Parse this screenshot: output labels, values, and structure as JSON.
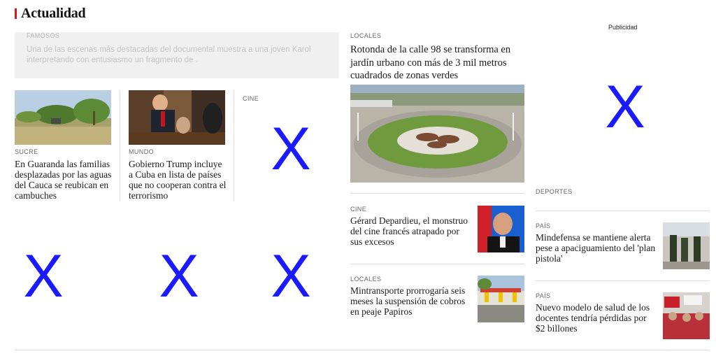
{
  "section": {
    "title": "Actualidad"
  },
  "ad": {
    "label": "Publicidad"
  },
  "famosos": {
    "kicker": "FAMOSOS",
    "text": "Una de las escenas más destacadas del documental muestra a una joven Karol interpretando con entusiasmo un fragmento de ."
  },
  "left_cards": [
    {
      "kicker": "SUCRE",
      "headline": "En Guaranda las familias desplazadas por las aguas del Cauca se reubican en cambuches"
    },
    {
      "kicker": "MUNDO",
      "headline": "Gobierno Trump incluye a Cuba en lista de países que no cooperan contra el terrorismo"
    },
    {
      "kicker": "CINE",
      "headline": ""
    }
  ],
  "center_main": {
    "kicker": "LOCALES",
    "headline": "Rotonda de la calle 98 se transforma en jardín urbano con más de 3 mil metros cuadrados de zonas verdes"
  },
  "center_list": [
    {
      "kicker": "CINE",
      "headline": "Gérard Depardieu, el monstruo del cine francés atrapado por sus excesos"
    },
    {
      "kicker": "LOCALES",
      "headline": "Mintransporte prorrogaría seis meses la suspensión de cobros en peaje Papiros"
    }
  ],
  "right_section": {
    "kicker": "DEPORTES"
  },
  "right_list": [
    {
      "kicker": "PAÍS",
      "headline": "Mindefensa se mantiene alerta pese a apaciguamiento del 'plan pistola'"
    },
    {
      "kicker": "PAÍS",
      "headline": "Nuevo modelo de salud de los docentes tendría pérdidas por $2 billones"
    }
  ],
  "placeholders": {
    "mark": "X"
  },
  "colors": {
    "accent": "#d8141e",
    "placeholder": "#1a1aff",
    "divider": "#dcdcdc"
  }
}
